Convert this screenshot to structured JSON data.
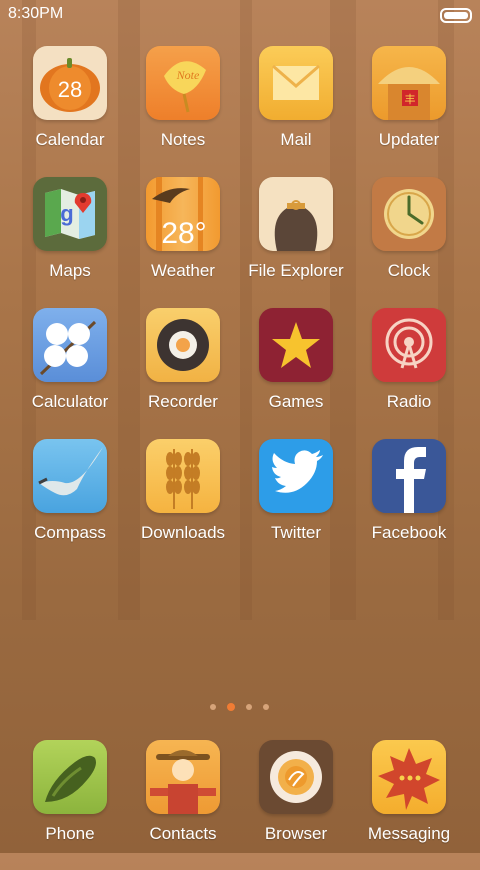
{
  "status_bar": {
    "time": "8:30PM"
  },
  "apps": [
    {
      "label": "Calendar",
      "icon": "pumpkin-calendar-icon",
      "date": "28"
    },
    {
      "label": "Notes",
      "icon": "ginkgo-note-icon",
      "text": "Note"
    },
    {
      "label": "Mail",
      "icon": "envelope-icon"
    },
    {
      "label": "Updater",
      "icon": "house-updater-icon"
    },
    {
      "label": "Maps",
      "icon": "map-pin-icon"
    },
    {
      "label": "Weather",
      "icon": "weather-bird-icon",
      "temperature": "28°"
    },
    {
      "label": "File Explorer",
      "icon": "sack-icon"
    },
    {
      "label": "Clock",
      "icon": "clock-icon"
    },
    {
      "label": "Calculator",
      "icon": "cotton-calculator-icon"
    },
    {
      "label": "Recorder",
      "icon": "record-icon"
    },
    {
      "label": "Games",
      "icon": "star-icon"
    },
    {
      "label": "Radio",
      "icon": "radio-signal-icon"
    },
    {
      "label": "Compass",
      "icon": "goose-compass-icon"
    },
    {
      "label": "Downloads",
      "icon": "wheat-download-icon"
    },
    {
      "label": "Twitter",
      "icon": "twitter-bird-icon"
    },
    {
      "label": "Facebook",
      "icon": "facebook-f-icon"
    }
  ],
  "page_indicator": {
    "count": 4,
    "active": 1
  },
  "dock": [
    {
      "label": "Phone",
      "icon": "cucumber-phone-icon"
    },
    {
      "label": "Contacts",
      "icon": "scarecrow-contacts-icon"
    },
    {
      "label": "Browser",
      "icon": "pie-browser-icon"
    },
    {
      "label": "Messaging",
      "icon": "maple-leaf-messaging-icon"
    }
  ]
}
